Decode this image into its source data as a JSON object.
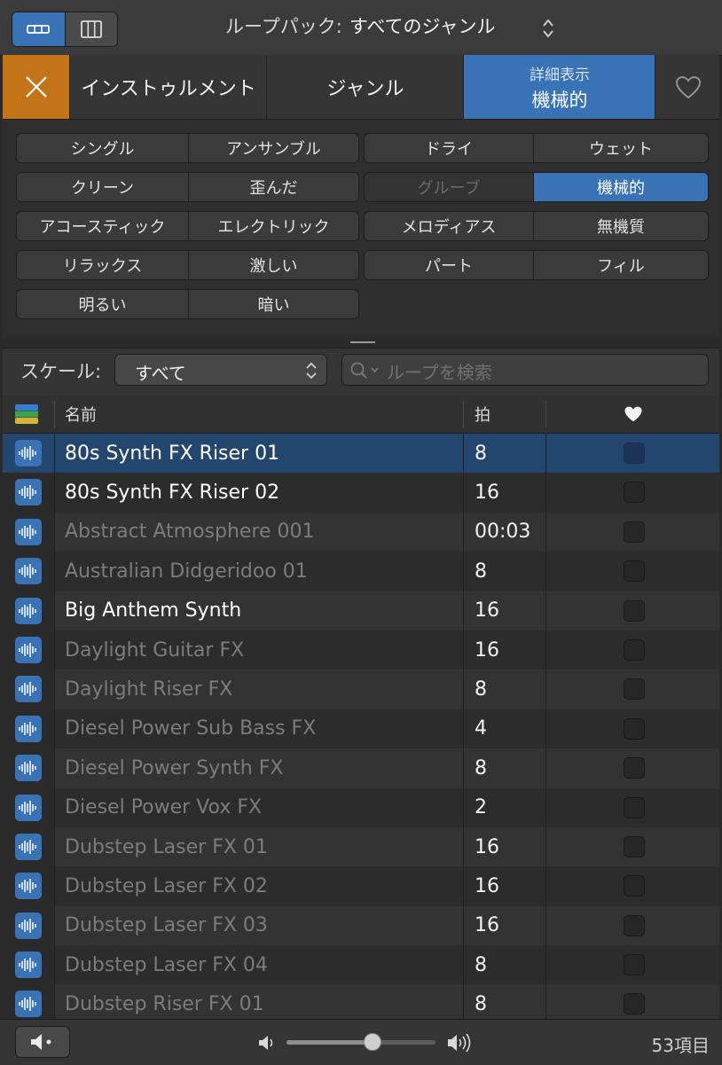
{
  "header": {
    "pack_label": "ループパック:",
    "pack_value": "すべてのジャンル"
  },
  "tabs": {
    "instrument": "インストゥルメント",
    "genre": "ジャンル",
    "detail_sub": "詳細表示",
    "detail_main": "機械的"
  },
  "keywords": [
    [
      "シングル",
      "アンサンブル",
      "ドライ",
      "ウェット"
    ],
    [
      "クリーン",
      "歪んだ",
      "グルーブ",
      "機械的"
    ],
    [
      "アコースティック",
      "エレクトリック",
      "メロディアス",
      "無機質"
    ],
    [
      "リラックス",
      "激しい",
      "パート",
      "フィル"
    ],
    [
      "明るい",
      "暗い"
    ]
  ],
  "keyword_selected": "機械的",
  "keyword_disabled": "グルーブ",
  "filter": {
    "scale_label": "スケール:",
    "scale_value": "すべて",
    "search_placeholder": "ループを検索"
  },
  "table": {
    "col_name": "名前",
    "col_beats": "拍",
    "rows": [
      {
        "name": "80s Synth FX Riser 01",
        "beats": "8",
        "dim": false,
        "selected": true
      },
      {
        "name": "80s Synth FX Riser 02",
        "beats": "16",
        "dim": false,
        "selected": false
      },
      {
        "name": "Abstract Atmosphere 001",
        "beats": "00:03",
        "dim": true,
        "selected": false
      },
      {
        "name": "Australian Didgeridoo 01",
        "beats": "8",
        "dim": true,
        "selected": false
      },
      {
        "name": "Big Anthem Synth",
        "beats": "16",
        "dim": false,
        "selected": false
      },
      {
        "name": "Daylight Guitar FX",
        "beats": "16",
        "dim": true,
        "selected": false
      },
      {
        "name": "Daylight Riser FX",
        "beats": "8",
        "dim": true,
        "selected": false
      },
      {
        "name": "Diesel Power Sub Bass FX",
        "beats": "4",
        "dim": true,
        "selected": false
      },
      {
        "name": "Diesel Power Synth FX",
        "beats": "8",
        "dim": true,
        "selected": false
      },
      {
        "name": "Diesel Power Vox FX",
        "beats": "2",
        "dim": true,
        "selected": false
      },
      {
        "name": "Dubstep Laser FX 01",
        "beats": "16",
        "dim": true,
        "selected": false
      },
      {
        "name": "Dubstep Laser FX 02",
        "beats": "16",
        "dim": true,
        "selected": false
      },
      {
        "name": "Dubstep Laser FX 03",
        "beats": "16",
        "dim": true,
        "selected": false
      },
      {
        "name": "Dubstep Laser FX 04",
        "beats": "8",
        "dim": true,
        "selected": false
      },
      {
        "name": "Dubstep Riser FX 01",
        "beats": "8",
        "dim": true,
        "selected": false
      }
    ]
  },
  "footer": {
    "volume_level": 0.58,
    "item_count": "53項目"
  },
  "colors": {
    "accent_blue": "#3a73b5",
    "close_orange": "#c47418"
  }
}
